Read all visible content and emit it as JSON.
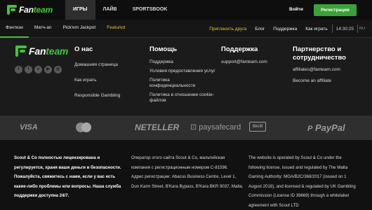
{
  "header": {
    "logo": {
      "part1": "Fan",
      "part2": "team"
    },
    "tabs": [
      "ИГРЫ",
      "ЛАЙВ",
      "SPORTSBOOK"
    ],
    "login_label": "Войти",
    "register_label": "Регистрация",
    "colors": {
      "accent": "#3fc43a",
      "register": "#3aa238",
      "featured": "#e6c72f"
    }
  },
  "subnav": {
    "left": [
      "Фэнтези",
      "Матч-ап",
      "Pick'em Jackpot",
      "Featured"
    ],
    "right": [
      "Пригласить друга",
      "Блог",
      "Поддержка",
      "Как играть"
    ],
    "time": "14:30:25",
    "lang": "RU"
  },
  "footer": {
    "socials": [
      "facebook-icon",
      "twitter-icon",
      "vk-icon",
      "youtube-icon",
      "instagram-icon"
    ],
    "about": {
      "title": "О нас",
      "links": [
        "Домашняя страница",
        "Как играть",
        "Responsible Gambling"
      ]
    },
    "help": {
      "title": "Помощь",
      "links": [
        "Поддержка",
        "Условия предоставления услуг",
        "Политика конфиденциальности",
        "Политика в отношении cookie-файлов"
      ]
    },
    "support": {
      "title": "Поддержка",
      "email": "support@fanteam.com"
    },
    "partners": {
      "title_line1": "Партнерство и",
      "title_line2": "сотрудничество",
      "email": "affiliates@fanteam.com",
      "become": "Become an affiliate"
    }
  },
  "payments": [
    "VISA",
    "mastercard",
    "NETELLER",
    "paysafecard",
    "Skrill",
    "PayPal"
  ],
  "legal": {
    "col1": [
      "Scout & Co полностью лицензирована и",
      "регулируется, храня ваши деньги в безопасности.",
      "Пожалуйста, свяжитесь с нами, если у вас есть",
      "какие-либо проблемы или вопросы. Наша служба",
      "поддержки доступна 24/7."
    ],
    "col2": [
      "Оператор этого сайта Scout & Co, мальтийская",
      "компания с регистрационным номером C-81596.",
      "Адрес регистрации: Abacus Business Centre, Level 1,",
      "Dun Karm Street, B'Kara Bypass, B'Kara BKR 9037, Malta."
    ],
    "col3": [
      "The website is operated by Scout & Co under the",
      "following license, issued and regulated by The Malta",
      "Gaming Authority: MGA/B2C/368/2017 (issued on 1",
      "August 2018), and licensed & regulated by UK Gambling",
      "Commission (License ID 39669) through a whitelabel",
      "agreement with Scout LTD"
    ]
  }
}
